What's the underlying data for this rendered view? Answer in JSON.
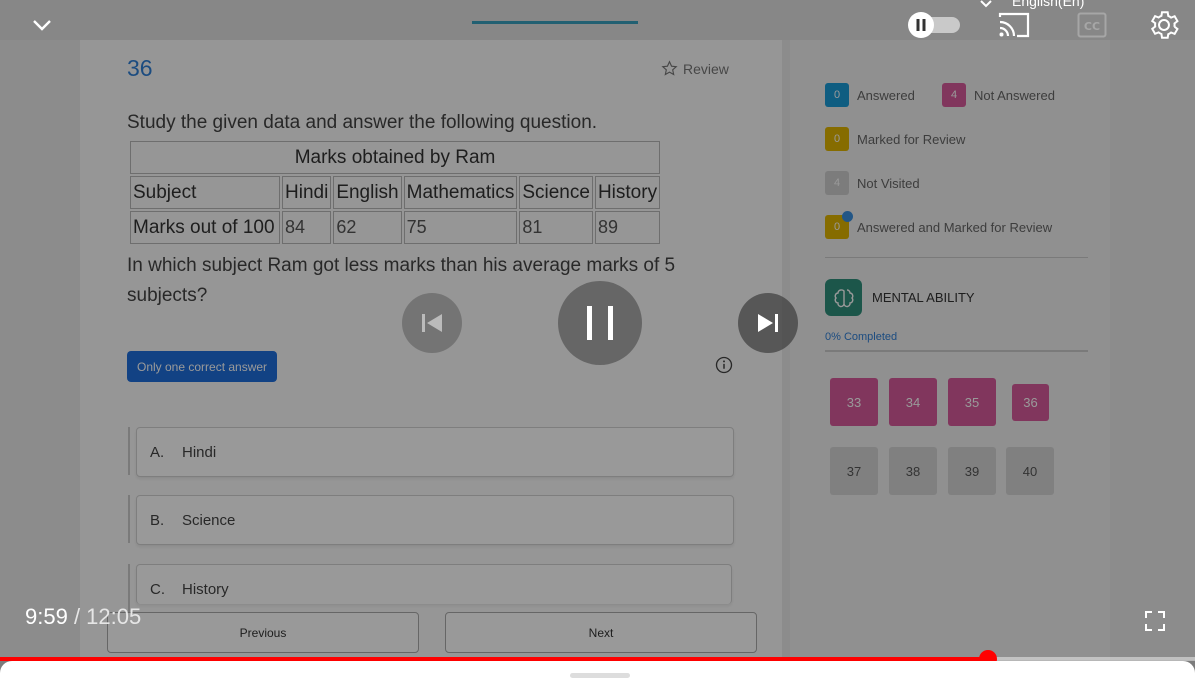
{
  "quiz": {
    "question_number": "36",
    "review_label": "Review",
    "instruction": "Study the given data and answer the following question.",
    "table": {
      "caption": "Marks obtained by Ram",
      "header": [
        "Subject",
        "Hindi",
        "English",
        "Mathematics",
        "Science",
        "History"
      ],
      "row": [
        "Marks out of 100",
        "84",
        "62",
        "75",
        "81",
        "89"
      ]
    },
    "question_text": " In which subject Ram got less marks than his average marks of 5 subjects?",
    "answer_type": "Only one correct answer",
    "options": [
      {
        "letter": "A.",
        "text": "Hindi"
      },
      {
        "letter": "B.",
        "text": "Science"
      },
      {
        "letter": "C.",
        "text": "History"
      }
    ],
    "previous_label": "Previous",
    "next_label": "Next"
  },
  "sidebar": {
    "legend": [
      {
        "count": "0",
        "label": "Answered",
        "color": "#1a9bd7"
      },
      {
        "count": "4",
        "label": "Not Answered",
        "color": "#d85a9b"
      },
      {
        "count": "0",
        "label": "Marked for Review",
        "color": "#e0b400"
      },
      {
        "count": "4",
        "label": "Not Visited",
        "color": "#cfcfcf"
      },
      {
        "count": "0",
        "label": "Answered and Marked for Review",
        "color": "#e0b400"
      }
    ],
    "section_name": "MENTAL ABILITY",
    "progress_text": "0% Completed",
    "progress_fraction": 0,
    "question_buttons": [
      {
        "num": "33",
        "status": "not-answered"
      },
      {
        "num": "34",
        "status": "not-answered"
      },
      {
        "num": "35",
        "status": "not-answered"
      },
      {
        "num": "36",
        "status": "not-answered"
      },
      {
        "num": "37",
        "status": "not-visited"
      },
      {
        "num": "38",
        "status": "not-visited"
      },
      {
        "num": "39",
        "status": "not-visited"
      },
      {
        "num": "40",
        "status": "not-visited"
      }
    ]
  },
  "player": {
    "language": "English(En)",
    "current_time": "9:59",
    "separator": " / ",
    "duration": "12:05",
    "progress_fraction": 0.827,
    "accent_color": "#ff0000",
    "icons": {
      "collapse": "chevron-down-icon",
      "autoplay": "autoplay-toggle-icon",
      "cast": "cast-icon",
      "captions": "captions-icon",
      "settings": "gear-icon",
      "previous": "skip-previous-icon",
      "pause": "pause-icon",
      "next": "skip-next-icon",
      "fullscreen": "fullscreen-icon"
    }
  }
}
